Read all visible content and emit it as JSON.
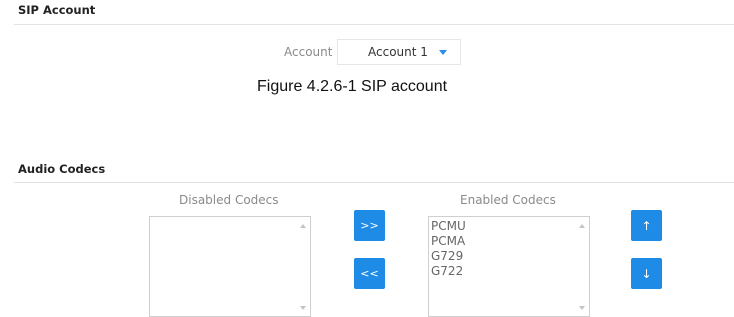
{
  "sip_section": {
    "title": "SIP Account",
    "account_label": "Account",
    "account_selected": "Account 1"
  },
  "caption": "Figure 4.2.6-1 SIP account",
  "audio_section": {
    "title": "Audio Codecs",
    "disabled_label": "Disabled Codecs",
    "enabled_label": "Enabled Codecs",
    "disabled_codecs": [],
    "enabled_codecs": [
      "PCMU",
      "PCMA",
      "G729",
      "G722"
    ],
    "move_right_label": ">>",
    "move_left_label": "<<",
    "move_up_label": "↑",
    "move_down_label": "↓"
  },
  "colors": {
    "accent": "#1e8ce6"
  },
  "icons": {
    "dropdown": "caret-down-icon",
    "scroll_up": "scroll-up-arrow-icon",
    "scroll_down": "scroll-down-arrow-icon"
  }
}
